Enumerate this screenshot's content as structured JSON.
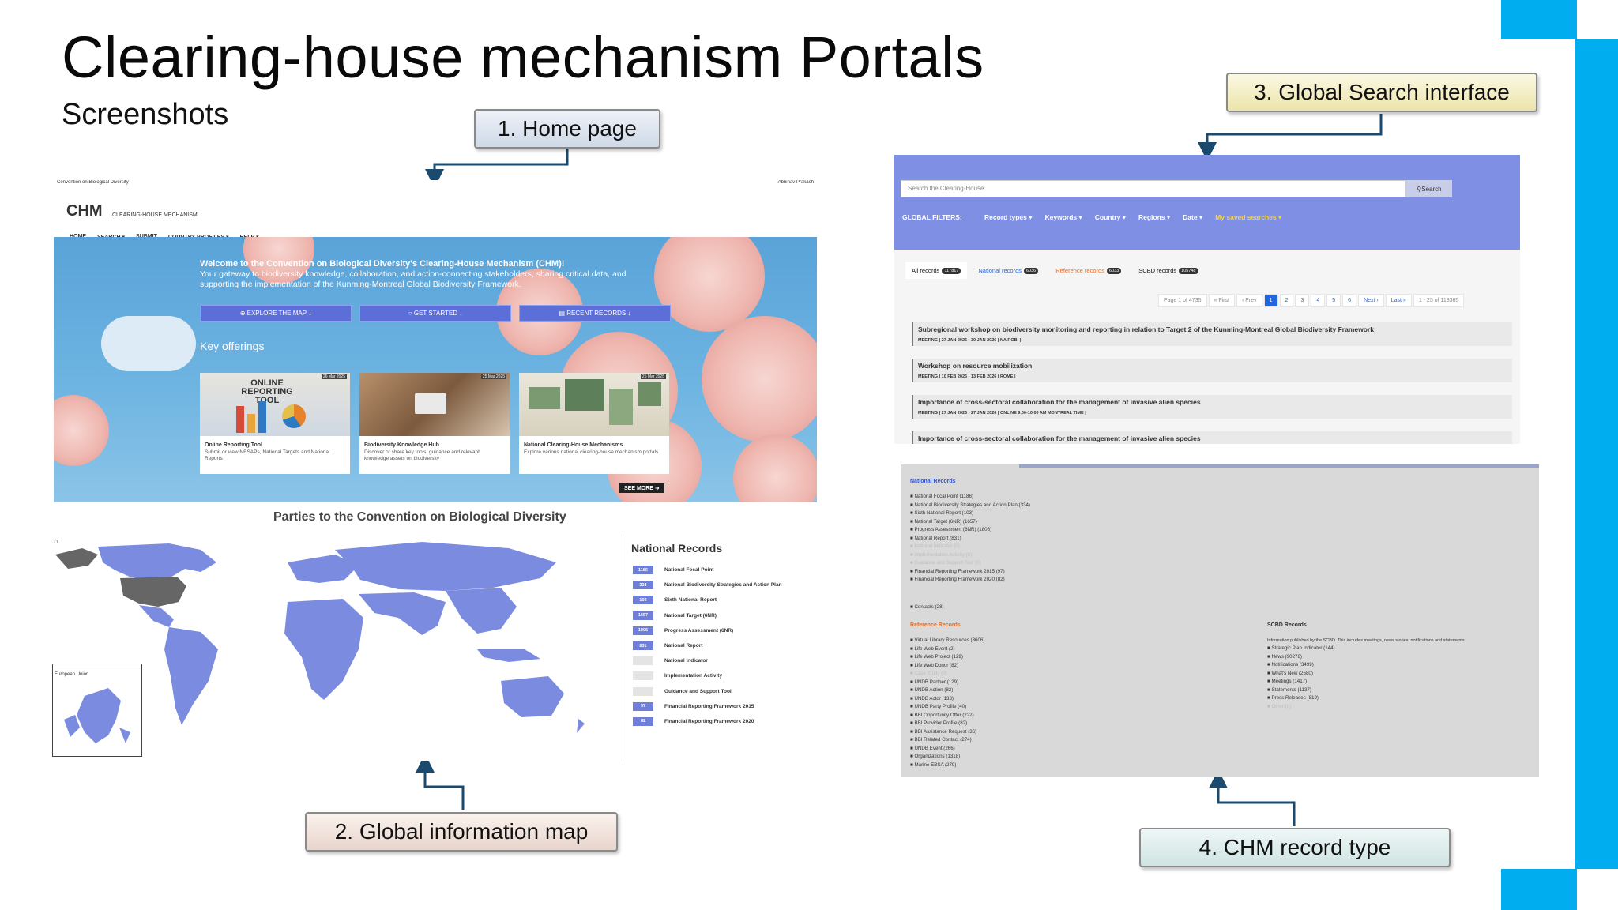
{
  "slide": {
    "title": "Clearing-house mechanism Portals",
    "subtitle": "Screenshots"
  },
  "callouts": {
    "home": "1. Home page",
    "map": "2. Global information map",
    "search": "3. Global Search  interface",
    "record": "4. CHM record type"
  },
  "home": {
    "topbar_left": "Convention on Biological Diversity",
    "topbar_user": "Abhinav Prakash",
    "logo": "CHM",
    "logo_sub": "CLEARING-HOUSE MECHANISM",
    "nav": [
      "HOME",
      "SEARCH ▾",
      "SUBMIT",
      "COUNTRY PROFILES ▾",
      "HELP ▾"
    ],
    "hero_title": "Welcome to the Convention on Biological Diversity's Clearing-House Mechanism (CHM)!",
    "hero_text": "Your gateway to biodiversity knowledge, collaboration, and action-connecting stakeholders, sharing critical data, and supporting the implementation of the Kunming-Montreal Global Biodiversity Framework.",
    "buttons": [
      "EXPLORE THE MAP",
      "GET STARTED",
      "RECENT RECORDS"
    ],
    "key_offerings": "Key offerings",
    "cards": [
      {
        "date": "26 Mar 2025",
        "img_text": "ONLINE REPORTING TOOL",
        "title": "Online Reporting Tool",
        "desc": "Submit or view NBSAPs, National Targets and National Reports"
      },
      {
        "date": "25 Mar 2025",
        "img_text": "",
        "title": "Biodiversity Knowledge Hub",
        "desc": "Discover or share key tools, guidance and relevant knowledge assets on biodiversity"
      },
      {
        "date": "25 Mar 2025",
        "img_text": "",
        "title": "National Clearing-House Mechanisms",
        "desc": "Explore various national clearing-house mechanism portals"
      }
    ],
    "see_more": "SEE MORE"
  },
  "map": {
    "title": "Parties to the Convention on Biological Diversity",
    "inset_label": "European Union",
    "legend_title": "National Records",
    "legend": [
      {
        "count": "1186",
        "label": "National Focal Point"
      },
      {
        "count": "334",
        "label": "National Biodiversity Strategies and Action Plan"
      },
      {
        "count": "103",
        "label": "Sixth National Report"
      },
      {
        "count": "1657",
        "label": "National Target (6NR)"
      },
      {
        "count": "1806",
        "label": "Progress Assessment (6NR)"
      },
      {
        "count": "831",
        "label": "National Report"
      },
      {
        "count": "",
        "label": "National Indicator"
      },
      {
        "count": "",
        "label": "Implementation Activity"
      },
      {
        "count": "",
        "label": "Guidance and Support Tool"
      },
      {
        "count": "97",
        "label": "Financial Reporting Framework 2015"
      },
      {
        "count": "82",
        "label": "Financial Reporting Framework 2020"
      }
    ]
  },
  "search": {
    "placeholder": "Search the Clearing-House",
    "button": "Search",
    "global_filters": "GLOBAL FILTERS:",
    "filters": [
      "Record types ▾",
      "Keywords ▾",
      "Country ▾",
      "Regions ▾",
      "Date ▾"
    ],
    "saved": "My saved searches ▾",
    "tabs": [
      {
        "label": "All records",
        "count": "117817"
      },
      {
        "label": "National records",
        "count": "6036"
      },
      {
        "label": "Reference records",
        "count": "6033"
      },
      {
        "label": "SCBD records",
        "count": "105748"
      }
    ],
    "pager": [
      "Page 1 of 4735",
      "« First",
      "‹ Prev",
      "1",
      "2",
      "3",
      "4",
      "5",
      "6",
      "Next ›",
      "Last »",
      "1 - 25 of 118365"
    ],
    "results": [
      {
        "title": "Subregional workshop on biodiversity monitoring and reporting in relation to Target 2 of the Kunming-Montreal Global Biodiversity Framework",
        "meta": "MEETING | 27 JAN 2026 - 30 JAN 2026 | NAIROBI |"
      },
      {
        "title": "Workshop on resource mobilization",
        "meta": "MEETING | 10 FEB 2026 - 13 FEB 2026 | ROME |"
      },
      {
        "title": "Importance of cross-sectoral collaboration for the management of invasive alien species",
        "meta": "MEETING | 27 JAN 2026 - 27 JAN 2026 | ONLINE 9.00-10.00 AM MONTREAL TIME |"
      },
      {
        "title": "Importance of cross-sectoral collaboration for the management of invasive alien species",
        "meta": ""
      }
    ]
  },
  "records": {
    "national_title": "National Records",
    "national": [
      "National Focal Point (1186)",
      "National Biodiversity Strategies and Action Plan (334)",
      "Sixth National Report (103)",
      "National Target (6NR) (1657)",
      "Progress Assessment (6NR) (1806)",
      "National Report (831)",
      "National Indicator (0)",
      "Implementation Activity (0)",
      "Guidance and Support Tool (0)",
      "Financial Reporting Framework 2015 (97)",
      "Financial Reporting Framework 2020 (82)"
    ],
    "contacts": "Contacts (28)",
    "reference_title": "Reference Records",
    "reference": [
      "Virtual Library Resources (3606)",
      "Life Web Event (2)",
      "Life Web Project (129)",
      "Life Web Donor (82)",
      "Case Study (0)",
      "UNDB Partner (129)",
      "UNDB Action (82)",
      "UNDB Actor (133)",
      "UNDB Party Profile (40)",
      "BBI Opportunity Offer (222)",
      "BBI Provider Profile (82)",
      "BBI Assistance Request (36)",
      "BBI Related Contact (274)",
      "UNDB Event (266)",
      "Organizations (1318)",
      "Marine EBSA (279)"
    ],
    "scbd_title": "SCBD Records",
    "scbd_note": "Information published by the SCBD. This includes meetings, news stories, notifications and statements",
    "scbd": [
      "Strategic Plan Indicator (144)",
      "News (90278)",
      "Notifications (3499)",
      "What's New (2580)",
      "Meetings (1417)",
      "Statements (1137)",
      "Press Releases (819)",
      "Other (0)"
    ]
  },
  "colors": {
    "accent": "#00aeef",
    "map_party": "#7b8ce0",
    "map_nonparty": "#666666",
    "search_bar": "#7f8fe3"
  }
}
